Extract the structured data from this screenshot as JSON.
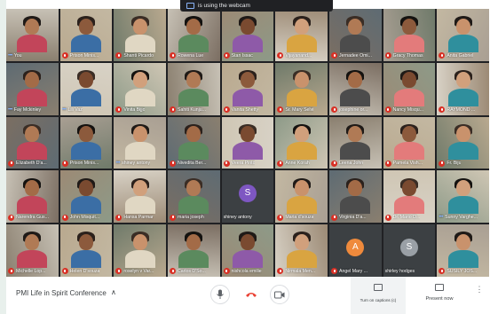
{
  "webcam_notice": "is using the webcam",
  "meeting_title": "PMI Life in Spirit Conference",
  "controls": {
    "captions_label": "Turn on captions (c)",
    "present_label": "Present now"
  },
  "colors": {
    "grid_bg": "#202124",
    "mute_red": "#d93025",
    "hangup_red": "#ea4335",
    "avatar_purple": "#7e57c2",
    "avatar_orange": "#ef8a3c",
    "avatar_gray": "#9aa0a6"
  },
  "participants": [
    {
      "name": "You",
      "status": "dots",
      "avatar": null
    },
    {
      "name": "Prison Minis...",
      "status": "muted",
      "avatar": null
    },
    {
      "name": "Shanti Picardo",
      "status": "muted",
      "avatar": null
    },
    {
      "name": "Rowena Lue",
      "status": "muted",
      "avatar": null
    },
    {
      "name": "Stan Issac",
      "status": "muted",
      "avatar": null
    },
    {
      "name": "Vijayanand...",
      "status": "muted",
      "avatar": null
    },
    {
      "name": "Jernadee Omi...",
      "status": "muted",
      "avatar": null
    },
    {
      "name": "Gracy Thomas",
      "status": "muted",
      "avatar": null
    },
    {
      "name": "Anita Gabriel",
      "status": "muted",
      "avatar": null
    },
    {
      "name": "Fay Mckinley",
      "status": "dots",
      "avatar": null
    },
    {
      "name": "Lili Vaz",
      "status": "dots",
      "avatar": null
    },
    {
      "name": "Vinita Bijjo",
      "status": "muted",
      "avatar": null
    },
    {
      "name": "Sahiti Kunju...",
      "status": "muted",
      "avatar": null
    },
    {
      "name": "Vanita Shetty",
      "status": "muted",
      "avatar": null
    },
    {
      "name": "Sr. Mary Selvi",
      "status": "muted",
      "avatar": null
    },
    {
      "name": "josephine or...",
      "status": "muted",
      "avatar": null
    },
    {
      "name": "Nancy Misqu...",
      "status": "muted",
      "avatar": null
    },
    {
      "name": "RAYMOND ...",
      "status": "muted",
      "avatar": null
    },
    {
      "name": "Elizabeth D'a...",
      "status": "muted",
      "avatar": null
    },
    {
      "name": "Prison Minis...",
      "status": "muted",
      "avatar": null
    },
    {
      "name": "shiney antony",
      "status": "dots",
      "avatar": null
    },
    {
      "name": "Nivedita Ber...",
      "status": "muted",
      "avatar": null
    },
    {
      "name": "Veera Pinto",
      "status": "muted",
      "avatar": null
    },
    {
      "name": "Anne Korah",
      "status": "muted",
      "avatar": null
    },
    {
      "name": "Leena John",
      "status": "muted",
      "avatar": null
    },
    {
      "name": "Pamela Vish...",
      "status": "muted",
      "avatar": null
    },
    {
      "name": "Fr. Biju",
      "status": "muted",
      "avatar": null
    },
    {
      "name": "Narendra Gus...",
      "status": "muted",
      "avatar": null
    },
    {
      "name": "John Misquit...",
      "status": "muted",
      "avatar": null
    },
    {
      "name": "Hansa Parmar",
      "status": "muted",
      "avatar": null
    },
    {
      "name": "maria joseph",
      "status": "muted",
      "avatar": null
    },
    {
      "name": "shiney antony",
      "status": "none",
      "avatar": {
        "letter": "S",
        "color": "#7e57c2"
      }
    },
    {
      "name": "Maria d'souza",
      "status": "muted",
      "avatar": null
    },
    {
      "name": "Virginia D'a...",
      "status": "muted",
      "avatar": null
    },
    {
      "name": "Dr. Mario D...",
      "status": "muted",
      "avatar": null
    },
    {
      "name": "Sunny Varghe...",
      "status": "dots",
      "avatar": null
    },
    {
      "name": "Michelle Lop...",
      "status": "muted",
      "avatar": null
    },
    {
      "name": "Helen D'souza",
      "status": "muted",
      "avatar": null
    },
    {
      "name": "roselyn v Var...",
      "status": "muted",
      "avatar": null
    },
    {
      "name": "Carlos D'So...",
      "status": "muted",
      "avatar": null
    },
    {
      "name": "nishcola emilie",
      "status": "muted",
      "avatar": null
    },
    {
      "name": "Nirmala Men...",
      "status": "muted",
      "avatar": null
    },
    {
      "name": "Angel Mary ...",
      "status": "muted",
      "avatar": {
        "letter": "A",
        "color": "#ef8a3c"
      }
    },
    {
      "name": "shirley hodges",
      "status": "none",
      "avatar": {
        "letter": "S",
        "color": "#9aa0a6"
      }
    },
    {
      "name": "SUSILY JOS...",
      "status": "muted",
      "avatar": null
    }
  ]
}
